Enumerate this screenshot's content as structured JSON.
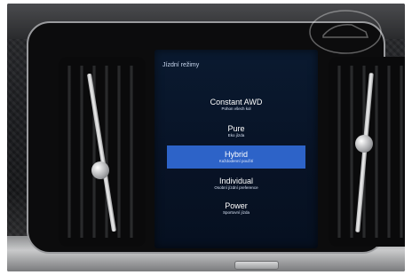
{
  "screen": {
    "title": "Jízdní režimy",
    "modes": [
      {
        "name": "Constant AWD",
        "subtitle": "Pohon všech kol",
        "selected": false
      },
      {
        "name": "Pure",
        "subtitle": "Eko jízda",
        "selected": false
      },
      {
        "name": "Hybrid",
        "subtitle": "Každodenní použití",
        "selected": true
      },
      {
        "name": "Individual",
        "subtitle": "Osobní jízdní preference",
        "selected": false
      },
      {
        "name": "Power",
        "subtitle": "Sportovní jízda",
        "selected": false
      }
    ]
  },
  "colors": {
    "selected_mode": "#2d63c8",
    "screen_background": "#0a1a30"
  }
}
